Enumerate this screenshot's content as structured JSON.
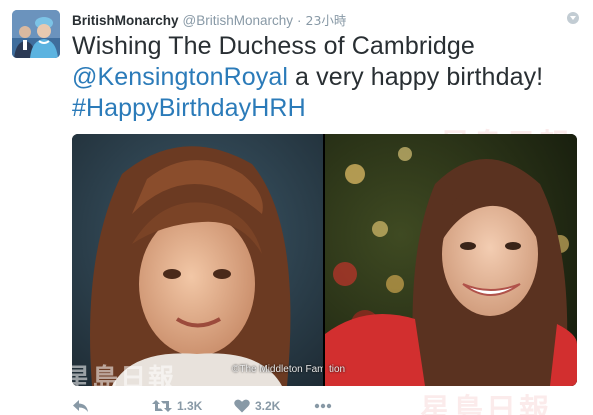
{
  "author": {
    "name": "BritishMonarchy",
    "handle": "@BritishMonarchy",
    "separator": "·",
    "time": "23小時"
  },
  "tweet": {
    "text_line1": "Wishing The Duchess of Cambridge",
    "mention": "@KensingtonRoyal",
    "text_line2_rest": " a very happy birthday!",
    "hashtag": "#HappyBirthdayHRH"
  },
  "media": {
    "photo_left_credit": "©The Middleton Fami",
    "photo_right_credit": "tion"
  },
  "actions": {
    "reply_icon": "reply-icon",
    "retweet_count": "1.3K",
    "like_count": "3.2K",
    "more_icon": "more-icon"
  },
  "colors": {
    "link": "#2b7bb9",
    "text": "#292f33",
    "muted": "#8899a6"
  }
}
